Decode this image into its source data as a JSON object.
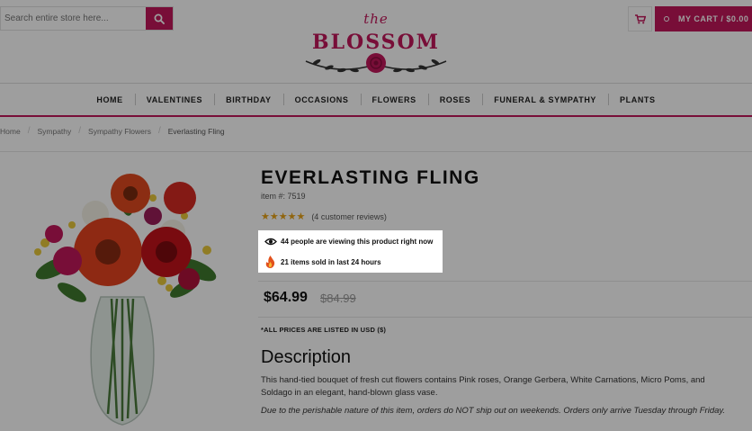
{
  "search": {
    "placeholder": "Search entire store here..."
  },
  "logo": {
    "tagline": "the",
    "name": "BLOSSOM"
  },
  "cart": {
    "label": "MY CART / $0.00"
  },
  "nav": {
    "items": [
      "HOME",
      "VALENTINES",
      "BIRTHDAY",
      "OCCASIONS",
      "FLOWERS",
      "ROSES",
      "FUNERAL & SYMPATHY",
      "PLANTS"
    ]
  },
  "breadcrumb": {
    "items": [
      "Home",
      "Sympathy",
      "Sympathy Flowers",
      "Everlasting Fling"
    ]
  },
  "product": {
    "title": "EVERLASTING FLING",
    "item_number": "item #: 7519",
    "rating_stars": 5,
    "reviews": "(4 customer reviews)",
    "viewing": "44 people are viewing this product right now",
    "sold": "21 items sold in last 24 hours",
    "price": "$64.99",
    "old_price": "$84.99",
    "currency_note": "*ALL PRICES ARE LISTED IN USD ($)"
  },
  "description": {
    "heading": "Description",
    "body": "This hand-tied bouquet of fresh cut flowers contains Pink roses, Orange Gerbera, White Carnations, Micro Poms, and Soldago in an elegant, hand-blown glass vase.",
    "note": "Due to the perishable nature of this item, orders do NOT ship out on weekends. Orders only arrive Tuesday through Friday."
  },
  "colors": {
    "accent": "#c2185b",
    "star": "#e8a317"
  }
}
